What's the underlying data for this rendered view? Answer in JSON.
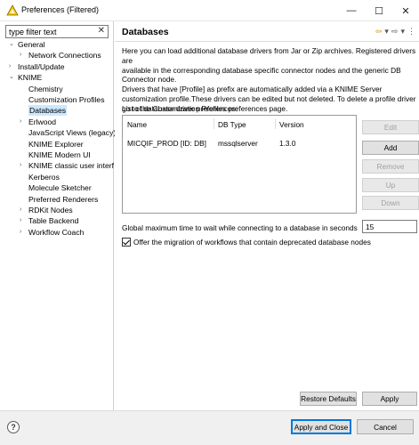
{
  "window": {
    "title": "Preferences (Filtered)",
    "minimize_glyph": "—",
    "maximize_glyph": "☐",
    "close_glyph": "✕"
  },
  "filter": {
    "value": "type filter text",
    "clear_glyph": "✕"
  },
  "tree": [
    {
      "label": "General",
      "level": 0,
      "expander": "expanded"
    },
    {
      "label": "Network Connections",
      "level": 1,
      "expander": "collapsed"
    },
    {
      "label": "Install/Update",
      "level": 0,
      "expander": "collapsed"
    },
    {
      "label": "KNIME",
      "level": 0,
      "expander": "expanded"
    },
    {
      "label": "Chemistry",
      "level": 1,
      "expander": "none"
    },
    {
      "label": "Customization Profiles",
      "level": 1,
      "expander": "none"
    },
    {
      "label": "Databases",
      "level": 1,
      "expander": "none",
      "selected": true
    },
    {
      "label": "Erlwood",
      "level": 1,
      "expander": "collapsed"
    },
    {
      "label": "JavaScript Views (legacy)",
      "level": 1,
      "expander": "none"
    },
    {
      "label": "KNIME Explorer",
      "level": 1,
      "expander": "none"
    },
    {
      "label": "KNIME Modern UI",
      "level": 1,
      "expander": "none"
    },
    {
      "label": "KNIME classic user interf",
      "level": 1,
      "expander": "collapsed"
    },
    {
      "label": "Kerberos",
      "level": 1,
      "expander": "none"
    },
    {
      "label": "Molecule Sketcher",
      "level": 1,
      "expander": "none"
    },
    {
      "label": "Preferred Renderers",
      "level": 1,
      "expander": "none"
    },
    {
      "label": "RDKit Nodes",
      "level": 1,
      "expander": "collapsed"
    },
    {
      "label": "Table Backend",
      "level": 1,
      "expander": "collapsed"
    },
    {
      "label": "Workflow Coach",
      "level": 1,
      "expander": "collapsed"
    }
  ],
  "page": {
    "title": "Databases",
    "desc_line1": "Here you can load additional database drivers from Jar or Zip archives. Registered drivers are",
    "desc_line2": "available in the corresponding database specific connector nodes and the generic DB",
    "desc_line3": "Connector node.",
    "desc_line4": "Drivers that have [Profile] as prefix are automatically added via a KNIME Server",
    "desc_line5": "customization profile.These drivers can be edited but not deleted. To delete a profile driver",
    "desc_line6": "go to the Customization Profiles preferences page.",
    "list_label": "List of database driver preferences:",
    "table": {
      "headers": [
        "Name",
        "DB Type",
        "Version"
      ],
      "rows": [
        [
          "MICQIF_PROD [ID: DB]",
          "mssqlserver",
          "1.3.0"
        ]
      ]
    },
    "buttons": {
      "edit": "Edit",
      "add": "Add",
      "remove": "Remove",
      "up": "Up",
      "down": "Down"
    },
    "timeout_label": "Global maximum time to wait while connecting to a database in seconds",
    "timeout_value": "15",
    "migration_label": "Offer the migration of workflows that contain deprecated database nodes",
    "migration_checked": true,
    "restore_defaults": "Restore Defaults",
    "apply": "Apply"
  },
  "bottom": {
    "help_glyph": "?",
    "apply_and_close": "Apply and Close",
    "cancel": "Cancel"
  },
  "nav": {
    "back_glyph": "⇦",
    "forward_glyph": "⇨",
    "dropdown_glyph": "▾",
    "menu_glyph": "⋮"
  }
}
